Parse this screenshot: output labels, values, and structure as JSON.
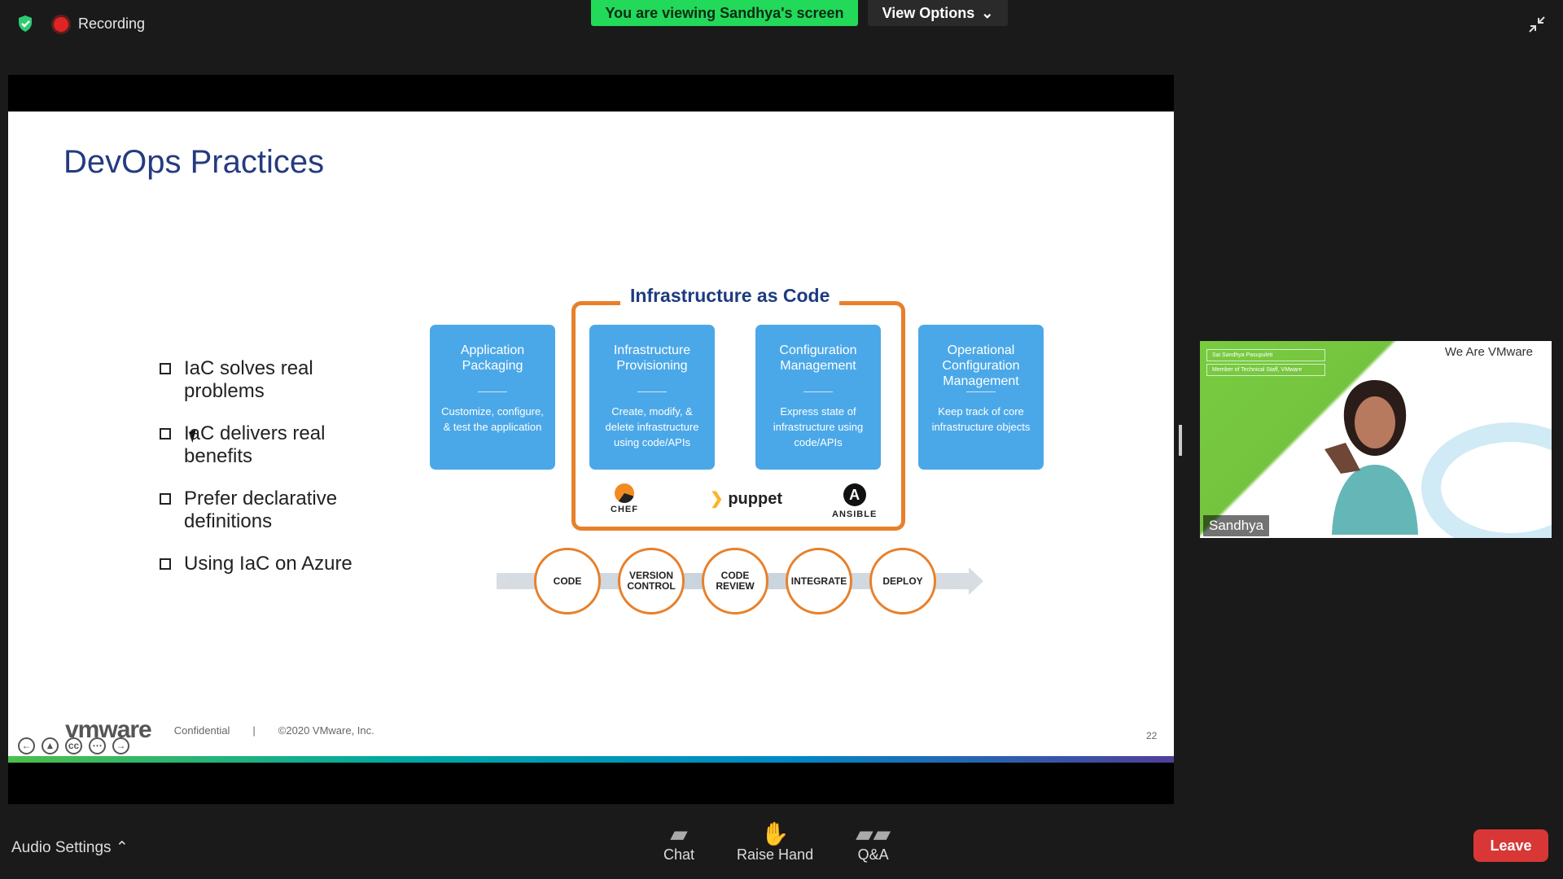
{
  "top": {
    "recording": "Recording",
    "banner": "You are viewing Sandhya's screen",
    "view_options": "View Options"
  },
  "slide": {
    "title": "DevOps Practices",
    "bullets": [
      "IaC solves real problems",
      "IaC delivers real benefits",
      "Prefer declarative definitions",
      "Using IaC on Azure"
    ],
    "iac_title": "Infrastructure as Code",
    "cards": [
      {
        "title": "Application Packaging",
        "text": "Customize, configure, & test the application"
      },
      {
        "title": "Infrastructure Provisioning",
        "text": "Create, modify, & delete infrastructure using code/APIs"
      },
      {
        "title": "Configuration Management",
        "text": "Express state of infrastructure using code/APIs"
      },
      {
        "title": "Operational Configuration Management",
        "text": "Keep track of core infrastructure objects"
      }
    ],
    "tools": {
      "chef": "CHEF",
      "puppet": "puppet",
      "ansible": "ANSIBLE"
    },
    "pipeline": [
      "CODE",
      "VERSION CONTROL",
      "CODE REVIEW",
      "INTEGRATE",
      "DEPLOY"
    ],
    "brand": "vmware",
    "confidential": "Confidential",
    "copyright": "©2020 VMware, Inc.",
    "page_number": "22"
  },
  "video": {
    "name": "Sandhya",
    "we_are": "We Are VMware",
    "tag_1": "Sai Sandhya Pasupuleti",
    "tag_2": "Member of Technical Staff, VMware"
  },
  "bottom": {
    "audio_settings": "Audio Settings",
    "chat": "Chat",
    "raise_hand": "Raise Hand",
    "qa": "Q&A",
    "leave": "Leave"
  }
}
